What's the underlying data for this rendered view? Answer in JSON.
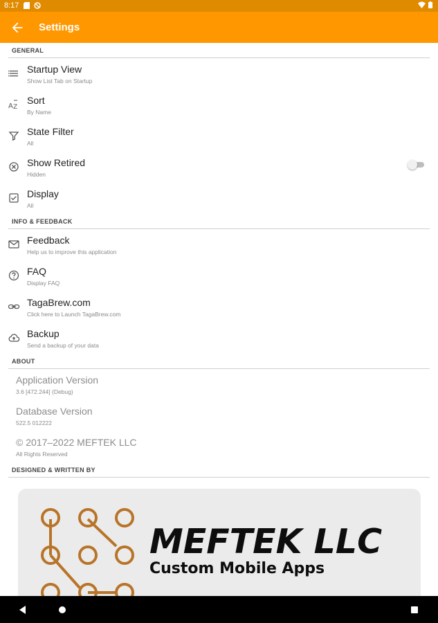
{
  "status_bar": {
    "time": "8:17"
  },
  "app_bar": {
    "title": "Settings",
    "back_icon": "arrow-back-icon"
  },
  "sections": {
    "general": "General",
    "info_feedback": "Info & Feedback",
    "about": "About",
    "designed_by": "Designed & Written By"
  },
  "general": [
    {
      "title": "Startup View",
      "summary": "Show List Tab on Startup",
      "icon": "list-icon"
    },
    {
      "title": "Sort",
      "summary": "By Name",
      "icon": "sort-az-icon"
    },
    {
      "title": "State Filter",
      "summary": "All",
      "icon": "filter-icon"
    },
    {
      "title": "Show Retired",
      "summary": "Hidden",
      "icon": "cancel-circle-icon",
      "toggle": false
    },
    {
      "title": "Display",
      "summary": "All",
      "icon": "checkbox-icon"
    }
  ],
  "info": [
    {
      "title": "Feedback",
      "summary": "Help us to improve this application",
      "icon": "mail-icon"
    },
    {
      "title": "FAQ",
      "summary": "Display FAQ",
      "icon": "help-circle-icon"
    },
    {
      "title": "TagaBrew.com",
      "summary": "Click here to Launch TagaBrew.com",
      "icon": "link-icon"
    },
    {
      "title": "Backup",
      "summary": "Send a backup of your data",
      "icon": "cloud-upload-icon"
    }
  ],
  "about": [
    {
      "title": "Application Version",
      "summary": "3.6 [472.244] (Debug)"
    },
    {
      "title": "Database Version",
      "summary": "522.5 012222"
    },
    {
      "title": "© 2017–2022 MEFTEK LLC",
      "summary": "All Rights Reserved"
    }
  ],
  "logo": {
    "name": "MEFTEK LLC",
    "tagline": "Custom Mobile Apps"
  },
  "colors": {
    "primary": "#ff9800",
    "status": "#e08a00",
    "logo_copper": "#b87428",
    "logo_bg": "#ebebeb"
  }
}
